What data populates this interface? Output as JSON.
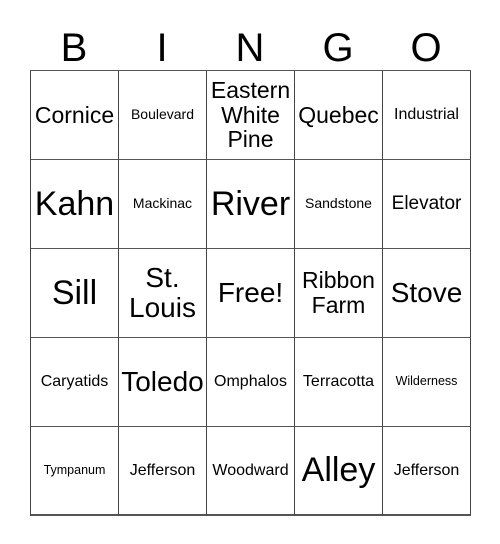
{
  "card": {
    "header_letters": [
      "B",
      "I",
      "N",
      "G",
      "O"
    ],
    "free_space_label": "Free!",
    "rows": [
      [
        {
          "text": "Cornice",
          "size": "xl"
        },
        {
          "text": "Boulevard",
          "size": "s"
        },
        {
          "text": "Eastern White Pine",
          "size": "xl"
        },
        {
          "text": "Quebec",
          "size": "xl"
        },
        {
          "text": "Industrial",
          "size": "m"
        }
      ],
      [
        {
          "text": "Kahn",
          "size": "xxxl"
        },
        {
          "text": "Mackinac",
          "size": "s"
        },
        {
          "text": "River",
          "size": "xxxl"
        },
        {
          "text": "Sandstone",
          "size": "s"
        },
        {
          "text": "Elevator",
          "size": "l"
        }
      ],
      [
        {
          "text": "Sill",
          "size": "xxxl"
        },
        {
          "text": "St. Louis",
          "size": "xxl"
        },
        {
          "text": "Free!",
          "size": "xxl"
        },
        {
          "text": "Ribbon Farm",
          "size": "xl"
        },
        {
          "text": "Stove",
          "size": "xxl"
        }
      ],
      [
        {
          "text": "Caryatids",
          "size": "m"
        },
        {
          "text": "Toledo",
          "size": "xxl"
        },
        {
          "text": "Omphalos",
          "size": "m"
        },
        {
          "text": "Terracotta",
          "size": "m"
        },
        {
          "text": "Wilderness",
          "size": "xs"
        }
      ],
      [
        {
          "text": "Tympanum",
          "size": "xs"
        },
        {
          "text": "Jefferson",
          "size": "m"
        },
        {
          "text": "Woodward",
          "size": "m"
        },
        {
          "text": "Alley",
          "size": "xxxl"
        },
        {
          "text": "Jefferson",
          "size": "m"
        }
      ]
    ]
  },
  "colors": {
    "background": "#ffffff",
    "cell_background": "#ffffff",
    "text": "#000000",
    "grid_line": "#555555"
  }
}
